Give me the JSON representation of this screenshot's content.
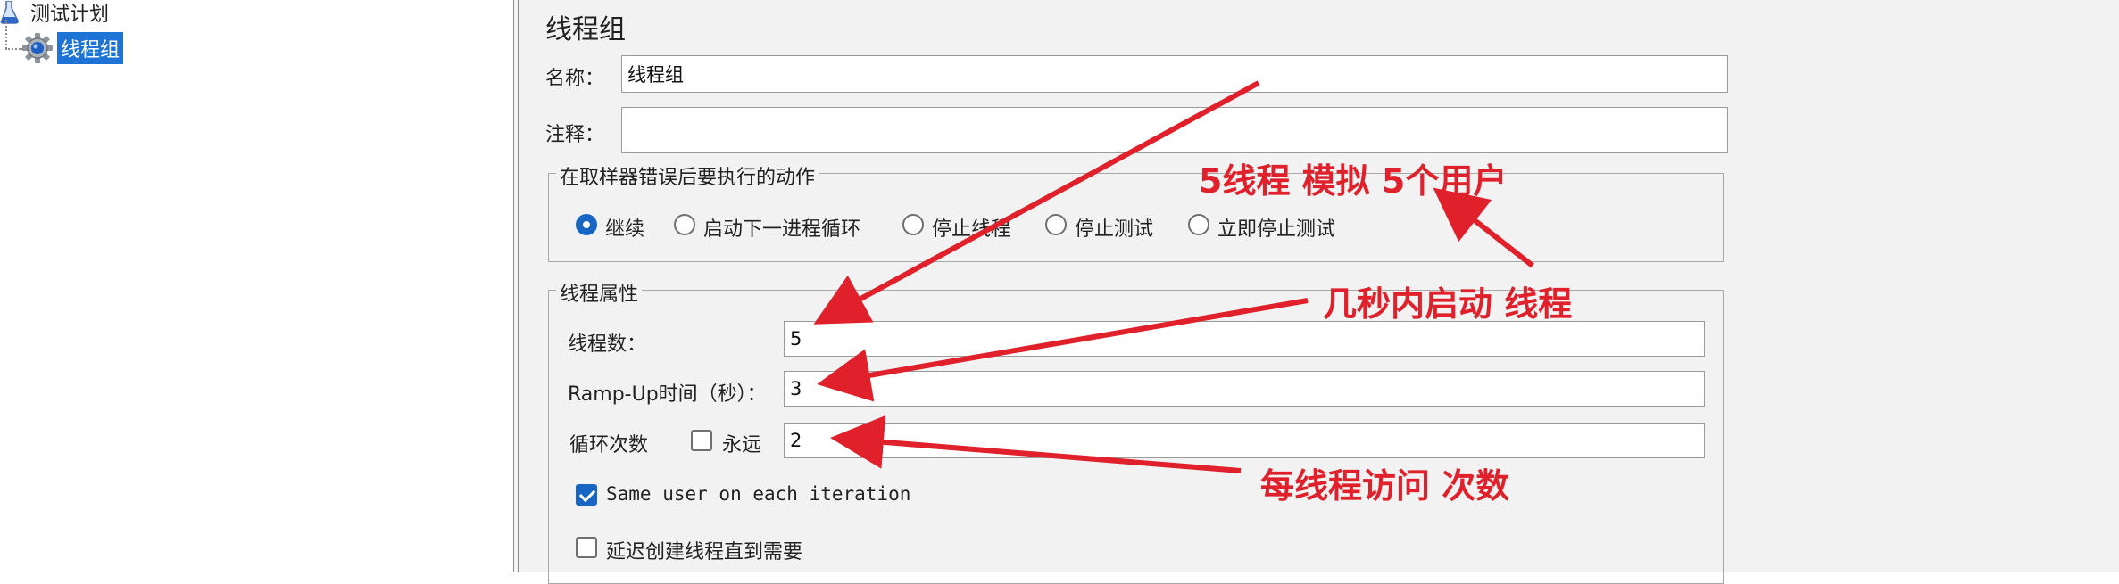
{
  "tree": {
    "root_label": "测试计划",
    "child_label": "线程组"
  },
  "panel": {
    "title": "线程组",
    "name_label": "名称：",
    "name_value": "线程组",
    "comment_label": "注释：",
    "comment_value": ""
  },
  "sampler_error": {
    "title": "在取样器错误后要执行的动作",
    "options": [
      {
        "label": "继续",
        "selected": true
      },
      {
        "label": "启动下一进程循环",
        "selected": false
      },
      {
        "label": "停止线程",
        "selected": false
      },
      {
        "label": "停止测试",
        "selected": false
      },
      {
        "label": "立即停止测试",
        "selected": false
      }
    ]
  },
  "thread_props": {
    "title": "线程属性",
    "threads_label": "线程数：",
    "threads_value": "5",
    "rampup_label": "Ramp-Up时间（秒）：",
    "rampup_value": "3",
    "loop_label": "循环次数",
    "forever_label": "永远",
    "forever_checked": false,
    "loop_value": "2",
    "same_user_label": "Same user on each iteration",
    "same_user_checked": true,
    "delay_label": "延迟创建线程直到需要",
    "delay_checked": false
  },
  "annotations": {
    "a1": "5线程   模拟   5个用户",
    "a2": "几秒内启动      线程",
    "a3": "每线程访问  次数",
    "color": "#e0202a"
  },
  "colors": {
    "selection": "#1e74d6",
    "accent": "#1766c4",
    "panel_bg": "#f2f2f2"
  }
}
